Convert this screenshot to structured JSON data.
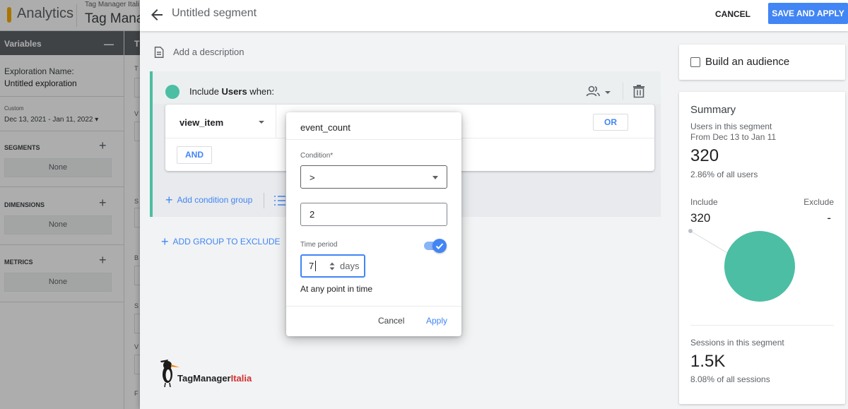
{
  "background": {
    "product_name": "Analytics",
    "account_small": "Tag Manager Itali",
    "account_big": "Tag Mana",
    "variables": {
      "header": "Variables",
      "minimize": "—",
      "exploration_label": "Exploration Name:",
      "exploration_name": "Untitled exploration",
      "date_custom": "Custom",
      "date_range": "Dec 13, 2021 - Jan 11, 2022",
      "date_caret": "▾",
      "sections": [
        {
          "title": "SEGMENTS",
          "plus": "+",
          "value": "None"
        },
        {
          "title": "DIMENSIONS",
          "plus": "+",
          "value": "None"
        },
        {
          "title": "METRICS",
          "plus": "+",
          "value": "None"
        }
      ]
    },
    "tab_settings": {
      "header": "T",
      "letters": [
        "T",
        "V",
        "S",
        "B",
        "S",
        "V",
        "F"
      ]
    }
  },
  "segment_header": {
    "title": "Untitled segment",
    "cancel_label": "CANCEL",
    "save_label": "SAVE AND APPLY"
  },
  "description_placeholder": "Add a description",
  "include_group": {
    "prefix": "Include ",
    "scope": "Users",
    "suffix": " when:",
    "condition": {
      "dimension": "view_item",
      "or_label": "OR",
      "and_label": "AND"
    },
    "add_condition_group": "Add condition group",
    "accent_color": "#4cbea3"
  },
  "add_group_exclude": "ADD GROUP TO EXCLUDE",
  "watermark": {
    "brand_main": "TagManager",
    "brand_accent": "Italia"
  },
  "audience": {
    "label": "Build an audience",
    "checked": false
  },
  "summary": {
    "title": "Summary",
    "users_label": "Users in this segment",
    "range": "From Dec 13 to Jan 11",
    "users_value": "320",
    "users_pct": "2.86% of all users",
    "include_label": "Include",
    "exclude_label": "Exclude",
    "include_value": "320",
    "exclude_value": "-",
    "sessions_label": "Sessions in this segment",
    "sessions_value": "1.5K",
    "sessions_pct": "8.08% of all sessions",
    "pie_color": "#4cbea3"
  },
  "popup": {
    "metric": "event_count",
    "condition_label": "Condition*",
    "condition_value": ">",
    "value": "2",
    "time_period_label": "Time period",
    "time_period_enabled": true,
    "days_value": "7",
    "days_unit": "days",
    "any_point": "At any point in time",
    "cancel_label": "Cancel",
    "apply_label": "Apply"
  },
  "colors": {
    "primary": "#4285f4",
    "accent": "#4cbea3"
  }
}
